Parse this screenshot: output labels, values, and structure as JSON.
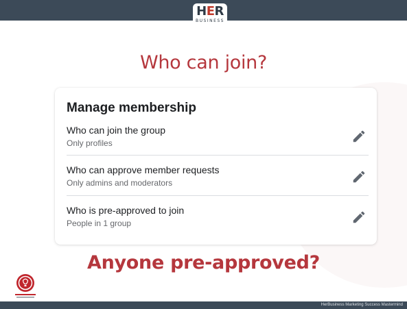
{
  "slide": {
    "logo": {
      "main": "HER",
      "sub": "BUSINESS"
    },
    "title": "Who can join?",
    "question": "Anyone pre-approved?",
    "footer": "HerBusiness Marketing Success Mastermind"
  },
  "card": {
    "title": "Manage membership",
    "settings": [
      {
        "label": "Who can join the group",
        "value": "Only profiles",
        "action_icon": "pencil-icon"
      },
      {
        "label": "Who can approve member requests",
        "value": "Only admins and moderators",
        "action_icon": "pencil-icon"
      },
      {
        "label": "Who is pre-approved to join",
        "value": "People in 1 group",
        "action_icon": "pencil-icon"
      }
    ]
  },
  "colors": {
    "bar": "#3c4a58",
    "accent_red": "#b5373d",
    "text_primary": "#1c1e21",
    "text_secondary": "#65676b",
    "icon_gray": "#606770"
  }
}
